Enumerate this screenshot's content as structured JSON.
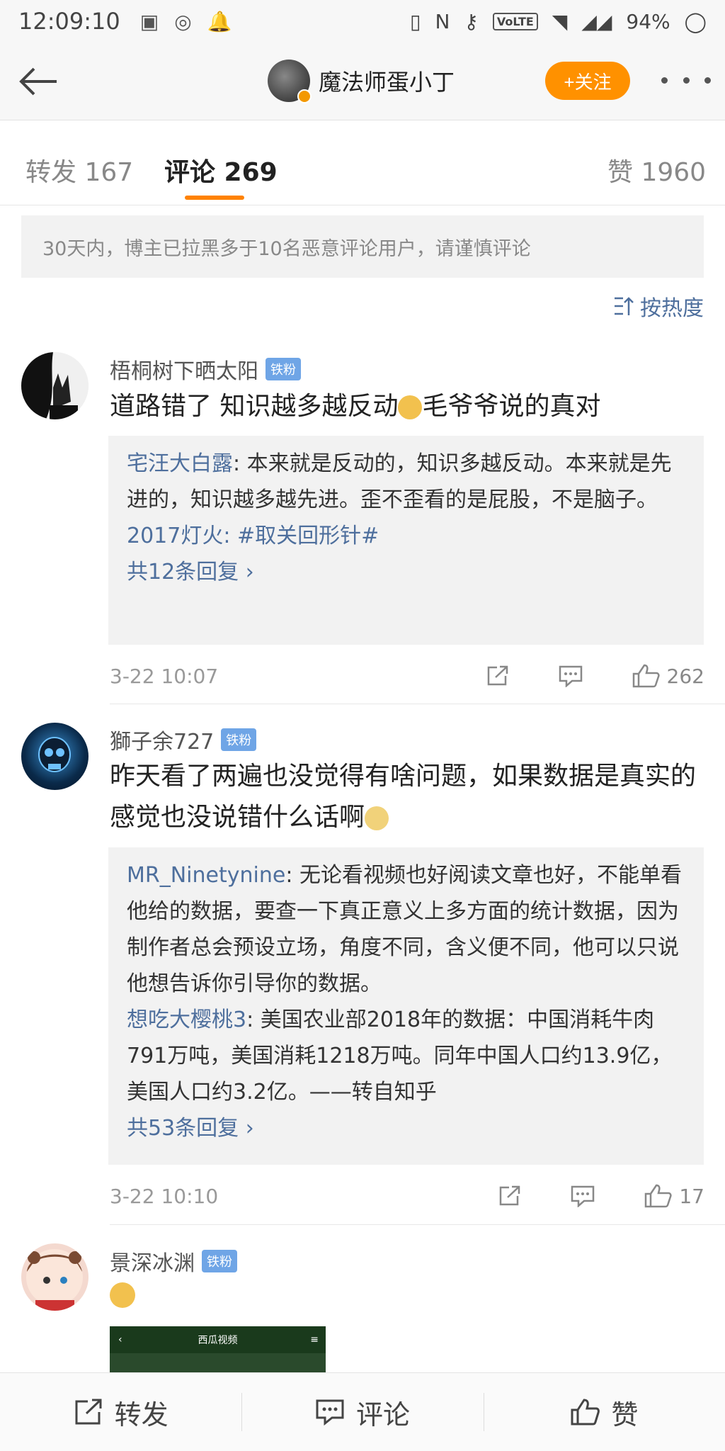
{
  "status_bar": {
    "time": "12:09:10",
    "battery": "94%",
    "network": "VoLTE"
  },
  "header": {
    "username": "魔法师蛋小丁",
    "follow_label": "+关注"
  },
  "tabs": [
    {
      "label": "转发 167"
    },
    {
      "label": "评论 269"
    },
    {
      "label": "赞 1960"
    }
  ],
  "notice": "30天内，博主已拉黑多于10名恶意评论用户，请谨慎评论",
  "sort_label": "按热度",
  "comments": [
    {
      "user": "梧桐树下晒太阳",
      "badge": "铁粉",
      "text_a": "道路错了 知识越多越反动",
      "text_b": "毛爷爷说的真对",
      "replies": [
        {
          "name": "宅汪大白露",
          "text": ": 本来就是反动的，知识多越反动。本来就是先进的，知识越多越先进。歪不歪看的是屁股，不是脑子。"
        },
        {
          "name": "2017灯火",
          "text": ": #取关回形针#"
        }
      ],
      "more_replies": "共12条回复 ›",
      "date": "3-22 10:07",
      "likes": "262"
    },
    {
      "user": "獅子余727",
      "badge": "铁粉",
      "text_a": "昨天看了两遍也没觉得有啥问题，如果数据是真实的感觉也没说错什么话啊",
      "replies": [
        {
          "name": "MR_Ninetynine",
          "text": ": 无论看视频也好阅读文章也好，不能单看他给的数据，要查一下真正意义上多方面的统计数据，因为制作者总会预设立场，角度不同，含义便不同，他可以只说他想告诉你引导你的数据。"
        },
        {
          "name": "想吃大樱桃3",
          "text": ": 美国农业部2018年的数据：中国消耗牛肉791万吨，美国消耗1218万吨。同年中国人口约13.9亿，美国人口约3.2亿。——转自知乎"
        }
      ],
      "more_replies": "共53条回复 ›",
      "date": "3-22 10:10",
      "likes": "17"
    },
    {
      "user": "景深冰渊",
      "badge": "铁粉",
      "thumb_title": "西瓜视频"
    }
  ],
  "bottom": {
    "repost": "转发",
    "comment": "评论",
    "like": "赞"
  }
}
